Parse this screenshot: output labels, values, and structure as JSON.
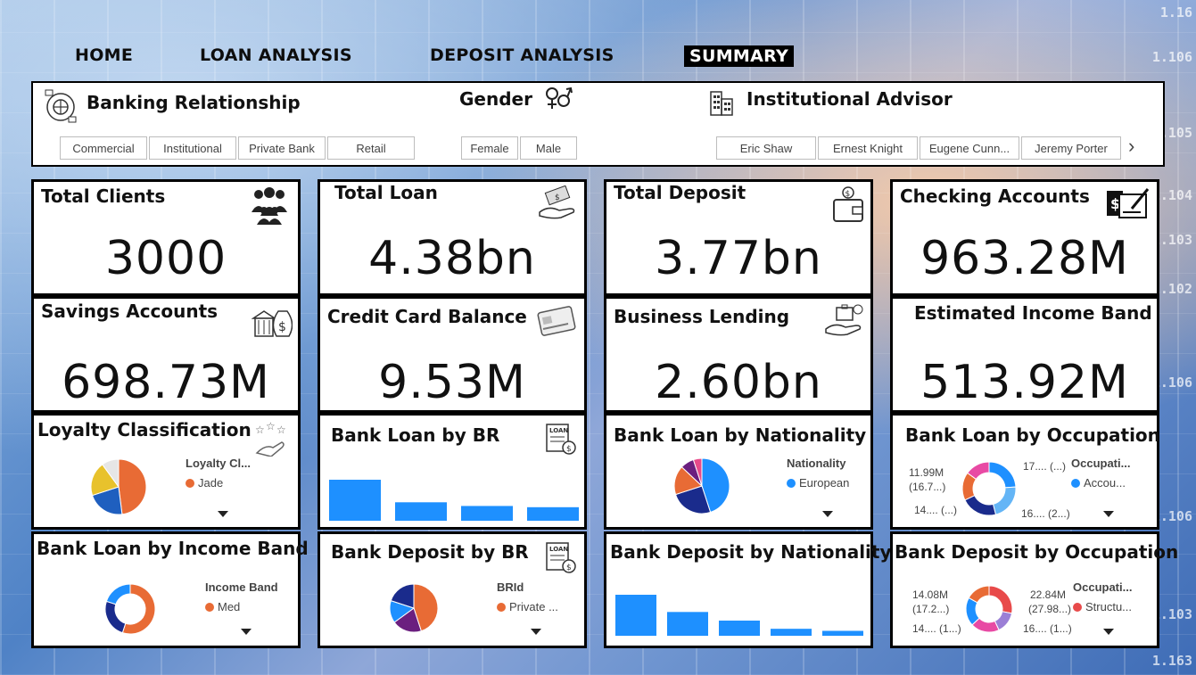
{
  "nav": {
    "home": "HOME",
    "loan_analysis": "LOAN ANALYSIS",
    "deposit_analysis": "DEPOSIT ANALYSIS",
    "summary": "SUMMARY"
  },
  "ticker": [
    "1.16",
    "1.106",
    "1.105",
    "1.104",
    "1.103",
    "1.102",
    "1.106",
    "1.106",
    "1.103",
    "1.163"
  ],
  "slicers": {
    "banking_relationship": {
      "title": "Banking Relationship",
      "options": [
        "Commercial",
        "Institutional",
        "Private Bank",
        "Retail"
      ]
    },
    "gender": {
      "title": "Gender",
      "options": [
        "Female",
        "Male"
      ]
    },
    "advisor": {
      "title": "Institutional Advisor",
      "options": [
        "Eric Shaw",
        "Ernest Knight",
        "Eugene Cunn...",
        "Jeremy Porter"
      ]
    }
  },
  "kpis": {
    "total_clients": {
      "title": "Total Clients",
      "value": "3000"
    },
    "total_loan": {
      "title": "Total Loan",
      "value": "4.38bn"
    },
    "total_deposit": {
      "title": "Total Deposit",
      "value": "3.77bn"
    },
    "checking": {
      "title": "Checking Accounts",
      "value": "963.28M"
    },
    "savings": {
      "title": "Savings Accounts",
      "value": "698.73M"
    },
    "credit_card": {
      "title": "Credit Card Balance",
      "value": "9.53M"
    },
    "business_lending": {
      "title": "Business Lending",
      "value": "2.60bn"
    },
    "income_band": {
      "title": "Estimated Income Band",
      "value": "513.92M"
    }
  },
  "charts": {
    "loyalty": {
      "title": "Loyalty Classification",
      "legend_title": "Loyalty Cl...",
      "legend_item": "Jade"
    },
    "loan_by_br": {
      "title": "Bank Loan by BR"
    },
    "loan_by_nationality": {
      "title": "Bank Loan by Nationality",
      "legend_title": "Nationality",
      "legend_item": "European"
    },
    "loan_by_occupation": {
      "title": "Bank Loan by Occupation",
      "legend_title": "Occupati...",
      "legend_item": "Accou...",
      "labels": {
        "top_left_1": "11.99M",
        "top_left_2": "(16.7...)",
        "top_right": "17.... (...)",
        "bottom_left": "14.... (...)",
        "bottom_right": "16.... (2...)"
      }
    },
    "loan_by_income_band": {
      "title": "Bank Loan by Income Band",
      "legend_title": "Income Band",
      "legend_item": "Med"
    },
    "deposit_by_br": {
      "title": "Bank Deposit by BR",
      "legend_title": "BRId",
      "legend_item": "Private ..."
    },
    "deposit_by_nationality": {
      "title": "Bank Deposit by Nationality"
    },
    "deposit_by_occupation": {
      "title": "Bank Deposit by Occupation",
      "legend_title": "Occupati...",
      "legend_item": "Structu...",
      "labels": {
        "top_left_1": "14.08M",
        "top_left_2": "(17.2...)",
        "top_right_1": "22.84M",
        "top_right_2": "(27.98...)",
        "bottom_left": "14.... (1...)",
        "bottom_right": "16.... (1...)"
      }
    }
  },
  "chart_data": [
    {
      "type": "pie",
      "name": "Loyalty Classification",
      "slices": [
        {
          "color": "#e86b35",
          "value": 0.48
        },
        {
          "color": "#1f5fbf",
          "value": 0.22
        },
        {
          "color": "#e8c22c",
          "value": 0.2
        },
        {
          "color": "#e6e6e6",
          "value": 0.1
        }
      ]
    },
    {
      "type": "bar",
      "name": "Bank Loan by BR",
      "values": [
        100,
        45,
        36,
        33
      ]
    },
    {
      "type": "pie",
      "name": "Bank Loan by Nationality",
      "slices": [
        {
          "color": "#1e90ff",
          "value": 0.45
        },
        {
          "color": "#1a2b8c",
          "value": 0.25
        },
        {
          "color": "#e86b35",
          "value": 0.17
        },
        {
          "color": "#6b1f7f",
          "value": 0.08
        },
        {
          "color": "#e84a8a",
          "value": 0.05
        }
      ]
    },
    {
      "type": "donut",
      "name": "Bank Loan by Occupation",
      "slices": [
        {
          "color": "#1e90ff",
          "value": 0.24
        },
        {
          "color": "#64b5f6",
          "value": 0.22
        },
        {
          "color": "#1a2b8c",
          "value": 0.22
        },
        {
          "color": "#e86b35",
          "value": 0.17
        },
        {
          "color": "#e84aa4",
          "value": 0.15
        }
      ]
    },
    {
      "type": "donut",
      "name": "Bank Loan by Income Band",
      "slices": [
        {
          "color": "#e86b35",
          "value": 0.55
        },
        {
          "color": "#1a2b8c",
          "value": 0.25
        },
        {
          "color": "#1e90ff",
          "value": 0.2
        }
      ]
    },
    {
      "type": "pie",
      "name": "Bank Deposit by BR",
      "slices": [
        {
          "color": "#e86b35",
          "value": 0.45
        },
        {
          "color": "#6b1f7f",
          "value": 0.2
        },
        {
          "color": "#1e90ff",
          "value": 0.15
        },
        {
          "color": "#1a2b8c",
          "value": 0.2
        }
      ]
    },
    {
      "type": "bar",
      "name": "Bank Deposit by Nationality",
      "values": [
        100,
        58,
        37,
        17,
        12
      ]
    },
    {
      "type": "donut",
      "name": "Bank Deposit by Occupation",
      "slices": [
        {
          "color": "#e84a4a",
          "value": 0.28
        },
        {
          "color": "#9b7fd6",
          "value": 0.15
        },
        {
          "color": "#e84aa4",
          "value": 0.2
        },
        {
          "color": "#1e90ff",
          "value": 0.2
        },
        {
          "color": "#e86b35",
          "value": 0.17
        }
      ]
    }
  ]
}
